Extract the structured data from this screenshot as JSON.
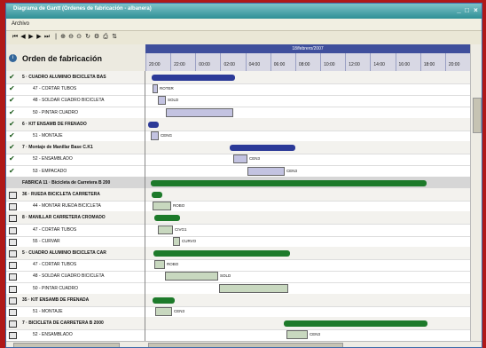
{
  "window": {
    "title": "Diagrama de Gantt (Ordenes de fabricación - albanera)"
  },
  "menu": {
    "archivo": "Archivo"
  },
  "grid": {
    "column_header": "Orden de fabricación"
  },
  "timeline": {
    "date": "18/febrero/2007",
    "hours": [
      "20:00",
      "22:00",
      "00:00",
      "02:00",
      "04:00",
      "06:00",
      "08:00",
      "10:00",
      "12:00",
      "14:00",
      "16:00",
      "18:00",
      "20:00"
    ]
  },
  "rows": [
    {
      "label": "5 · CUADRO ALUMINIO BICICLETA BAS",
      "kind": "group",
      "mark": "check"
    },
    {
      "label": "47 - CORTAR TUBOS",
      "kind": "task",
      "mark": "check"
    },
    {
      "label": "48 - SOLDAR CUADRO BICICLETA",
      "kind": "task",
      "mark": "check"
    },
    {
      "label": "50 - PINTAR CUADRO",
      "kind": "task",
      "mark": "check"
    },
    {
      "label": "6 · KIT ENSAMB DE FRENADO",
      "kind": "group",
      "mark": "check"
    },
    {
      "label": "51 - MONTAJE",
      "kind": "task",
      "mark": "check"
    },
    {
      "label": "7 · Montaje de Manillar Base C.K1",
      "kind": "group",
      "mark": "check"
    },
    {
      "label": "52 - ENSAMBLADO",
      "kind": "task",
      "mark": "check"
    },
    {
      "label": "53 - EMPACADO",
      "kind": "task",
      "mark": "check"
    },
    {
      "label": "FABRICA  11 · Bicicleta de Carretera B 200",
      "kind": "factory",
      "mark": "none"
    },
    {
      "label": "36 · RUEDA BICICLETA CARRETERA",
      "kind": "group",
      "mark": "page"
    },
    {
      "label": "44 - MONTAR RUEDA BICICLETA",
      "kind": "task",
      "mark": "page"
    },
    {
      "label": "8 · MANILLAR CARRETERA CROMADO",
      "kind": "group",
      "mark": "page"
    },
    {
      "label": "47 - CORTAR TUBOS",
      "kind": "task",
      "mark": "page"
    },
    {
      "label": "55 - CURVAR",
      "kind": "task",
      "mark": "page"
    },
    {
      "label": "5 · CUADRO ALUMINIO BICICLETA CAR",
      "kind": "group",
      "mark": "page"
    },
    {
      "label": "47 - CORTAR TUBOS",
      "kind": "task",
      "mark": "page"
    },
    {
      "label": "48 - SOLDAR CUADRO BICICLETA",
      "kind": "task",
      "mark": "page"
    },
    {
      "label": "50 - PINTAR CUADRO",
      "kind": "task",
      "mark": "page"
    },
    {
      "label": "35 · KIT ENSAMB DE FRENADA",
      "kind": "group",
      "mark": "page"
    },
    {
      "label": "51 - MONTAJE",
      "kind": "task",
      "mark": "page"
    },
    {
      "label": "7 · BICICLETA DE CARRETERA B 2000",
      "kind": "group",
      "mark": "page"
    },
    {
      "label": "52 - ENSAMBLADO",
      "kind": "task",
      "mark": "page"
    }
  ],
  "bars": [
    {
      "row": 0,
      "type": "summary",
      "color": "blue"
    },
    {
      "row": 1,
      "type": "task",
      "color": "lav",
      "label": "ROTER"
    },
    {
      "row": 2,
      "type": "task",
      "color": "lav",
      "label": "SOLD"
    },
    {
      "row": 3,
      "type": "task",
      "color": "lav",
      "label": ""
    },
    {
      "row": 4,
      "type": "summary",
      "color": "blue"
    },
    {
      "row": 5,
      "type": "task",
      "color": "lav",
      "label": "CENG"
    },
    {
      "row": 6,
      "type": "summary",
      "color": "blue"
    },
    {
      "row": 7,
      "type": "task",
      "color": "lav",
      "label": "CEN3"
    },
    {
      "row": 8,
      "type": "task",
      "color": "lav",
      "label": "CEN3"
    },
    {
      "row": 9,
      "type": "summary",
      "color": "green"
    },
    {
      "row": 10,
      "type": "summary",
      "color": "green"
    },
    {
      "row": 11,
      "type": "task",
      "color": "sage",
      "label": "ROBO"
    },
    {
      "row": 12,
      "type": "summary",
      "color": "green"
    },
    {
      "row": 13,
      "type": "task",
      "color": "sage",
      "label": "CIVG1"
    },
    {
      "row": 14,
      "type": "task",
      "color": "sage",
      "label": "CURVO"
    },
    {
      "row": 15,
      "type": "summary",
      "color": "green"
    },
    {
      "row": 16,
      "type": "task",
      "color": "sage",
      "label": "ROBO"
    },
    {
      "row": 17,
      "type": "task",
      "color": "sage",
      "label": "SOLD"
    },
    {
      "row": 18,
      "type": "task",
      "color": "sage",
      "label": ""
    },
    {
      "row": 19,
      "type": "summary",
      "color": "green"
    },
    {
      "row": 20,
      "type": "task",
      "color": "sage",
      "label": "CEN3"
    },
    {
      "row": 21,
      "type": "summary",
      "color": "green"
    },
    {
      "row": 22,
      "type": "task",
      "color": "sage",
      "label": "CEN3"
    }
  ]
}
